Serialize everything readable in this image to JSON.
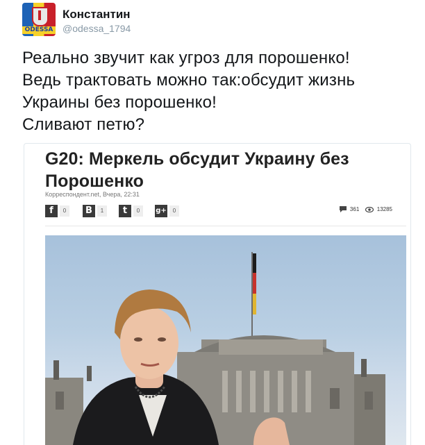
{
  "tweet": {
    "user_name": "Константин",
    "handle": "@odessa_1794",
    "avatar_label": "ODESSA",
    "text": "Реально звучит как угроз для порошенко!\nВедь трактовать можно так:обсудит жизнь\nУкраины без порошенко!\nСливают петю?"
  },
  "article": {
    "title": "G20: Меркель обсудит Украину без Порошенко",
    "meta": "Корреспондент.net, Вчера, 22:31",
    "share_buttons": [
      {
        "icon": "facebook-icon",
        "glyph": "f",
        "count": "0"
      },
      {
        "icon": "vk-icon",
        "glyph": "B",
        "count": "1"
      },
      {
        "icon": "twitter-icon",
        "glyph": "t",
        "count": "0"
      },
      {
        "icon": "google-plus-icon",
        "glyph": "g+",
        "count": "0"
      }
    ],
    "comments_count": "361",
    "views_count": "13285"
  }
}
